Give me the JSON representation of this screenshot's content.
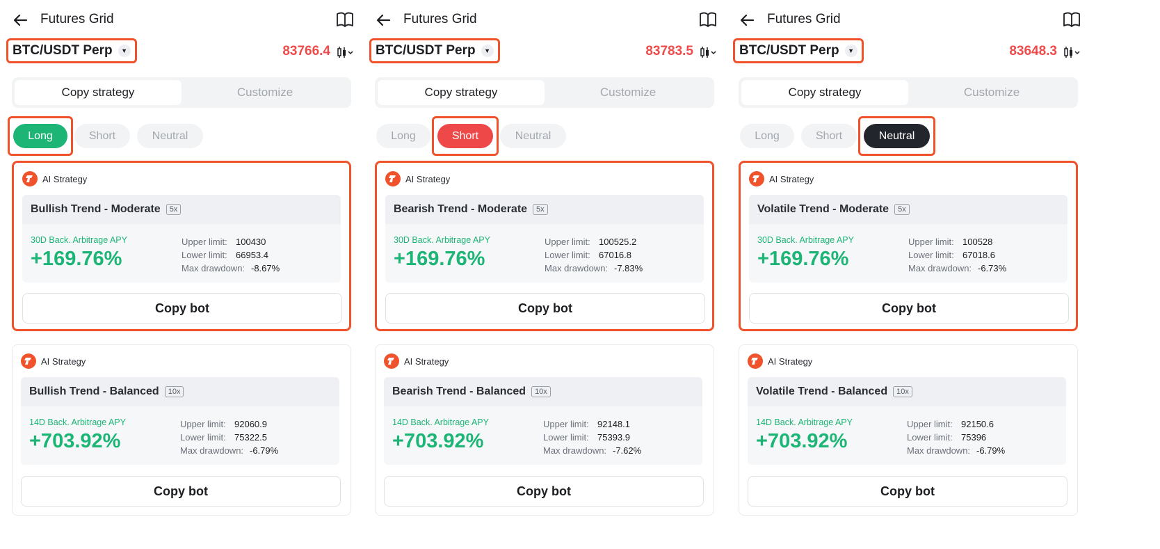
{
  "colors": {
    "highlight": "#f0532c",
    "long": "#1db576",
    "short": "#ef4848",
    "neutral": "#22262c",
    "price": "#ef4b4b"
  },
  "panels": [
    {
      "title": "Futures Grid",
      "pair": "BTC/USDT Perp",
      "price": "83766.4",
      "tabs": [
        "Copy strategy",
        "Customize"
      ],
      "directions": [
        "Long",
        "Short",
        "Neutral"
      ],
      "active_direction": "Long",
      "cards": [
        {
          "ai_label": "AI Strategy",
          "title": "Bullish Trend - Moderate",
          "leverage": "5x",
          "apy_label": "30D Back. Arbitrage APY",
          "apy": "+169.76%",
          "upper_key": "Upper limit:",
          "upper": "100430",
          "lower_key": "Lower limit:",
          "lower": "66953.4",
          "dd_key": "Max drawdown:",
          "dd": "-8.67%",
          "button": "Copy bot"
        },
        {
          "ai_label": "AI Strategy",
          "title": "Bullish Trend - Balanced",
          "leverage": "10x",
          "apy_label": "14D Back. Arbitrage APY",
          "apy": "+703.92%",
          "upper_key": "Upper limit:",
          "upper": "92060.9",
          "lower_key": "Lower limit:",
          "lower": "75322.5",
          "dd_key": "Max drawdown:",
          "dd": "-6.79%",
          "button": "Copy bot"
        }
      ]
    },
    {
      "title": "Futures Grid",
      "pair": "BTC/USDT Perp",
      "price": "83783.5",
      "tabs": [
        "Copy strategy",
        "Customize"
      ],
      "directions": [
        "Long",
        "Short",
        "Neutral"
      ],
      "active_direction": "Short",
      "cards": [
        {
          "ai_label": "AI Strategy",
          "title": "Bearish Trend - Moderate",
          "leverage": "5x",
          "apy_label": "30D Back. Arbitrage APY",
          "apy": "+169.76%",
          "upper_key": "Upper limit:",
          "upper": "100525.2",
          "lower_key": "Lower limit:",
          "lower": "67016.8",
          "dd_key": "Max drawdown:",
          "dd": "-7.83%",
          "button": "Copy bot"
        },
        {
          "ai_label": "AI Strategy",
          "title": "Bearish Trend - Balanced",
          "leverage": "10x",
          "apy_label": "14D Back. Arbitrage APY",
          "apy": "+703.92%",
          "upper_key": "Upper limit:",
          "upper": "92148.1",
          "lower_key": "Lower limit:",
          "lower": "75393.9",
          "dd_key": "Max drawdown:",
          "dd": "-7.62%",
          "button": "Copy bot"
        }
      ]
    },
    {
      "title": "Futures Grid",
      "pair": "BTC/USDT Perp",
      "price": "83648.3",
      "tabs": [
        "Copy strategy",
        "Customize"
      ],
      "directions": [
        "Long",
        "Short",
        "Neutral"
      ],
      "active_direction": "Neutral",
      "cards": [
        {
          "ai_label": "AI Strategy",
          "title": "Volatile Trend - Moderate",
          "leverage": "5x",
          "apy_label": "30D Back. Arbitrage APY",
          "apy": "+169.76%",
          "upper_key": "Upper limit:",
          "upper": "100528",
          "lower_key": "Lower limit:",
          "lower": "67018.6",
          "dd_key": "Max drawdown:",
          "dd": "-6.73%",
          "button": "Copy bot"
        },
        {
          "ai_label": "AI Strategy",
          "title": "Volatile Trend - Balanced",
          "leverage": "10x",
          "apy_label": "14D Back. Arbitrage APY",
          "apy": "+703.92%",
          "upper_key": "Upper limit:",
          "upper": "92150.6",
          "lower_key": "Lower limit:",
          "lower": "75396",
          "dd_key": "Max drawdown:",
          "dd": "-6.79%",
          "button": "Copy bot"
        }
      ]
    }
  ]
}
